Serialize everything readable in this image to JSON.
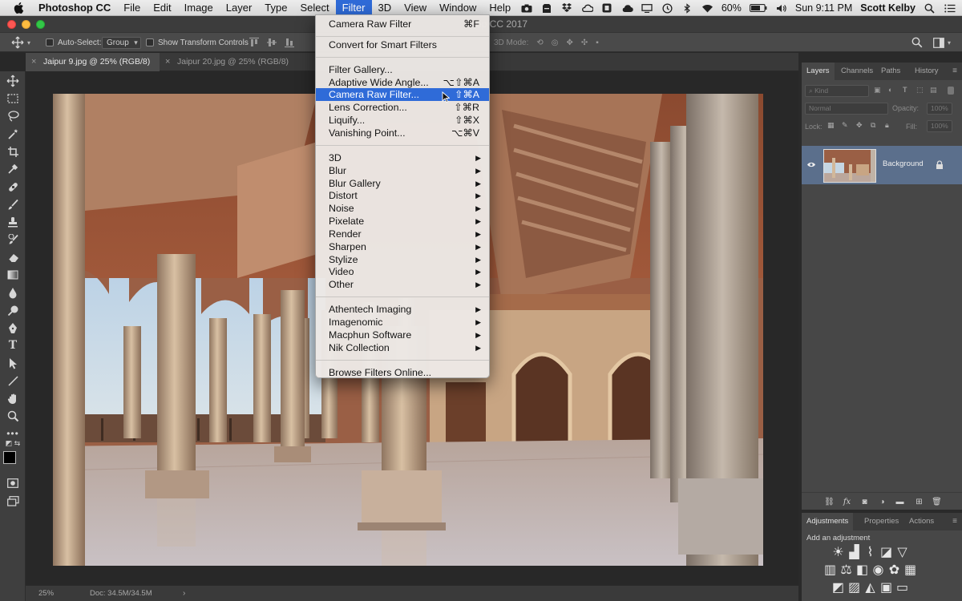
{
  "menubar": {
    "app_name": "Photoshop CC",
    "items": [
      "File",
      "Edit",
      "Image",
      "Layer",
      "Type",
      "Select",
      "Filter",
      "3D",
      "View",
      "Window",
      "Help"
    ],
    "active_item": "Filter",
    "battery": "60%",
    "clock": "Sun 9:11 PM",
    "user": "Scott Kelby"
  },
  "window": {
    "title_fragment": "op CC 2017"
  },
  "options_bar": {
    "auto_select_label": "Auto-Select:",
    "auto_select_value": "Group",
    "show_transform_label": "Show Transform Controls",
    "mode_3d_label": "3D Mode:"
  },
  "tabs": [
    {
      "label": "Jaipur 9.jpg @ 25% (RGB/8)",
      "active": true
    },
    {
      "label": "Jaipur 20.jpg @ 25% (RGB/8)",
      "active": false
    }
  ],
  "status_bar": {
    "zoom": "25%",
    "doc_info": "Doc: 34.5M/34.5M"
  },
  "filter_menu": {
    "groups": [
      [
        {
          "label": "Camera Raw Filter",
          "shortcut": "⌘F"
        }
      ],
      [
        {
          "label": "Convert for Smart Filters",
          "shortcut": ""
        }
      ],
      [
        {
          "label": "Filter Gallery...",
          "shortcut": ""
        },
        {
          "label": "Adaptive Wide Angle...",
          "shortcut": "⌥⇧⌘A"
        },
        {
          "label": "Camera Raw Filter...",
          "shortcut": "⇧⌘A",
          "highlighted": true
        },
        {
          "label": "Lens Correction...",
          "shortcut": "⇧⌘R"
        },
        {
          "label": "Liquify...",
          "shortcut": "⇧⌘X"
        },
        {
          "label": "Vanishing Point...",
          "shortcut": "⌥⌘V"
        }
      ],
      [
        {
          "label": "3D",
          "submenu": true
        },
        {
          "label": "Blur",
          "submenu": true
        },
        {
          "label": "Blur Gallery",
          "submenu": true
        },
        {
          "label": "Distort",
          "submenu": true
        },
        {
          "label": "Noise",
          "submenu": true
        },
        {
          "label": "Pixelate",
          "submenu": true
        },
        {
          "label": "Render",
          "submenu": true
        },
        {
          "label": "Sharpen",
          "submenu": true
        },
        {
          "label": "Stylize",
          "submenu": true
        },
        {
          "label": "Video",
          "submenu": true
        },
        {
          "label": "Other",
          "submenu": true
        }
      ],
      [
        {
          "label": "Athentech Imaging",
          "submenu": true
        },
        {
          "label": "Imagenomic",
          "submenu": true
        },
        {
          "label": "Macphun Software",
          "submenu": true
        },
        {
          "label": "Nik Collection",
          "submenu": true
        }
      ],
      [
        {
          "label": "Browse Filters Online...",
          "shortcut": ""
        }
      ]
    ]
  },
  "layers_panel": {
    "tabs": [
      "Layers",
      "Channels",
      "Paths",
      "History"
    ],
    "kind_placeholder": "Kind",
    "blend_mode": "Normal",
    "opacity_label": "Opacity:",
    "opacity_value": "100%",
    "lock_label": "Lock:",
    "fill_label": "Fill:",
    "fill_value": "100%",
    "layer_name": "Background"
  },
  "adjustments_panel": {
    "tabs": [
      "Adjustments",
      "Properties",
      "Actions"
    ],
    "add_label": "Add an adjustment"
  },
  "colors": {
    "accent": "#2f6bd8",
    "menu_bg": "#ece8e5",
    "panel_bg": "#474747",
    "selected_layer": "#5b6f8c"
  }
}
